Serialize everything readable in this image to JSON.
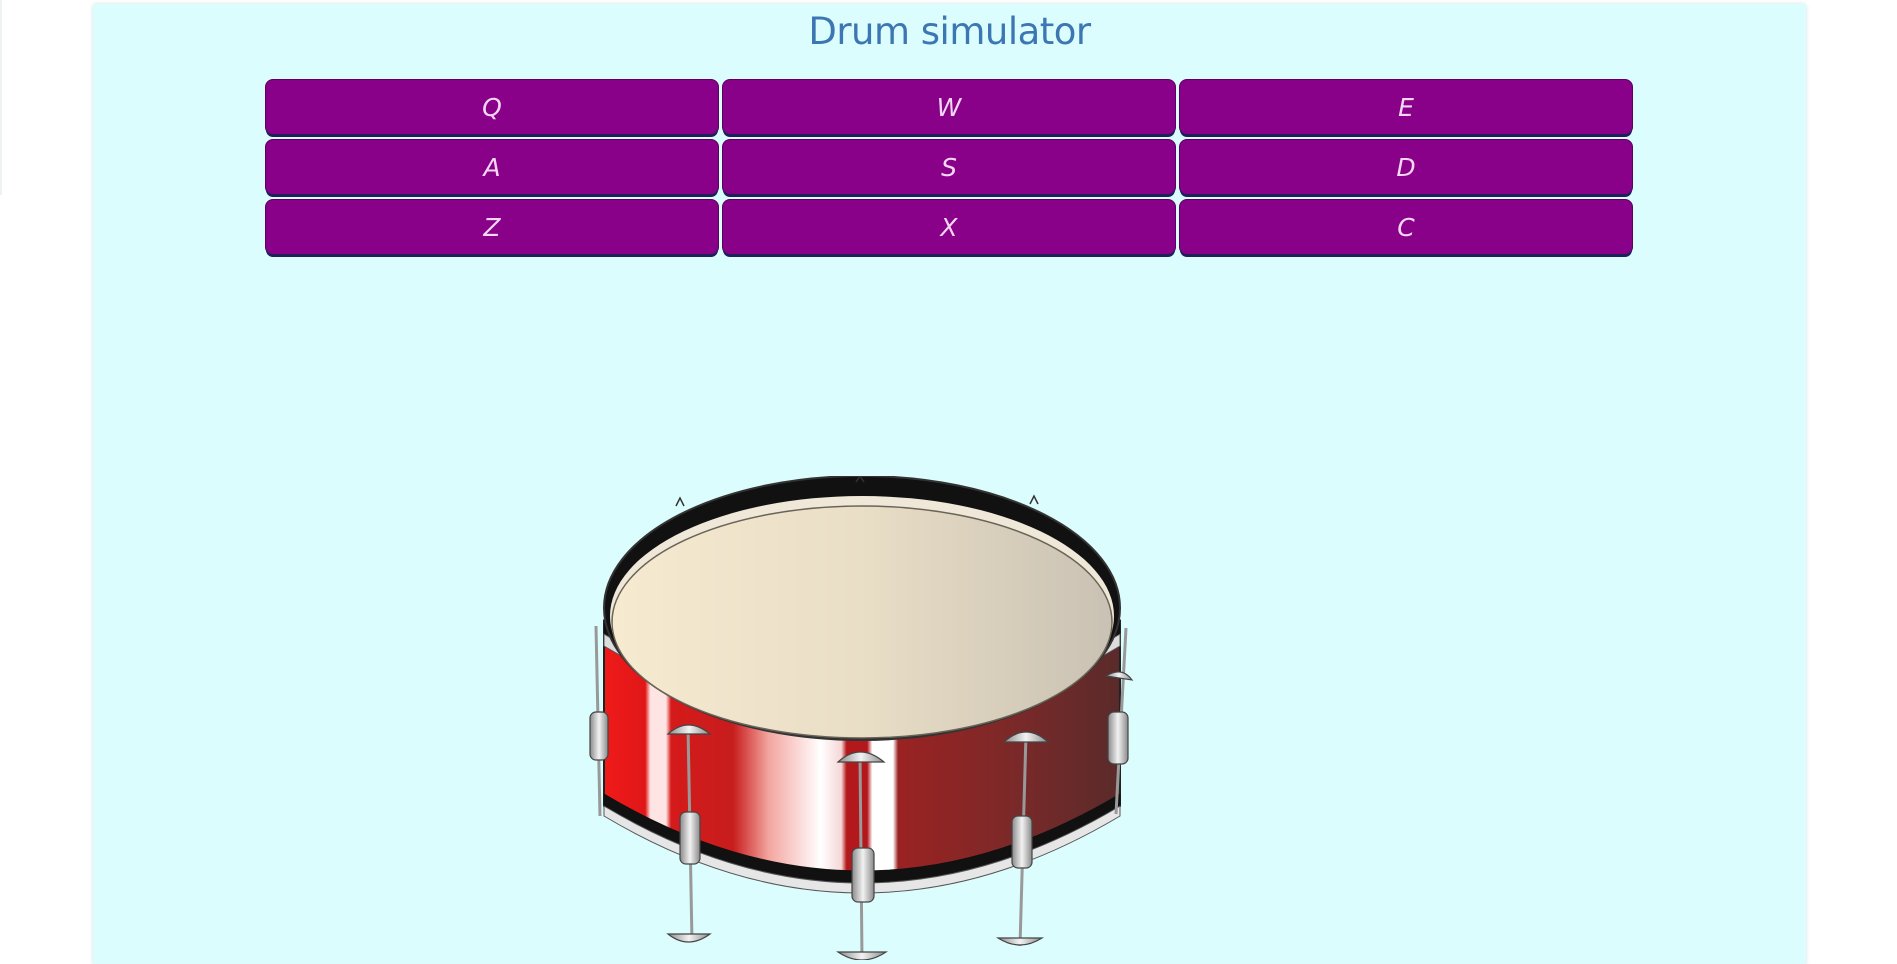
{
  "app": {
    "title": "Drum simulator"
  },
  "pads": [
    {
      "key": "Q"
    },
    {
      "key": "W"
    },
    {
      "key": "E"
    },
    {
      "key": "A"
    },
    {
      "key": "S"
    },
    {
      "key": "D"
    },
    {
      "key": "Z"
    },
    {
      "key": "X"
    },
    {
      "key": "C"
    }
  ],
  "colors": {
    "background": "#dbfdfd",
    "pad": "#890089",
    "title": "#3d77b3"
  },
  "image": {
    "subject": "snare-drum"
  }
}
